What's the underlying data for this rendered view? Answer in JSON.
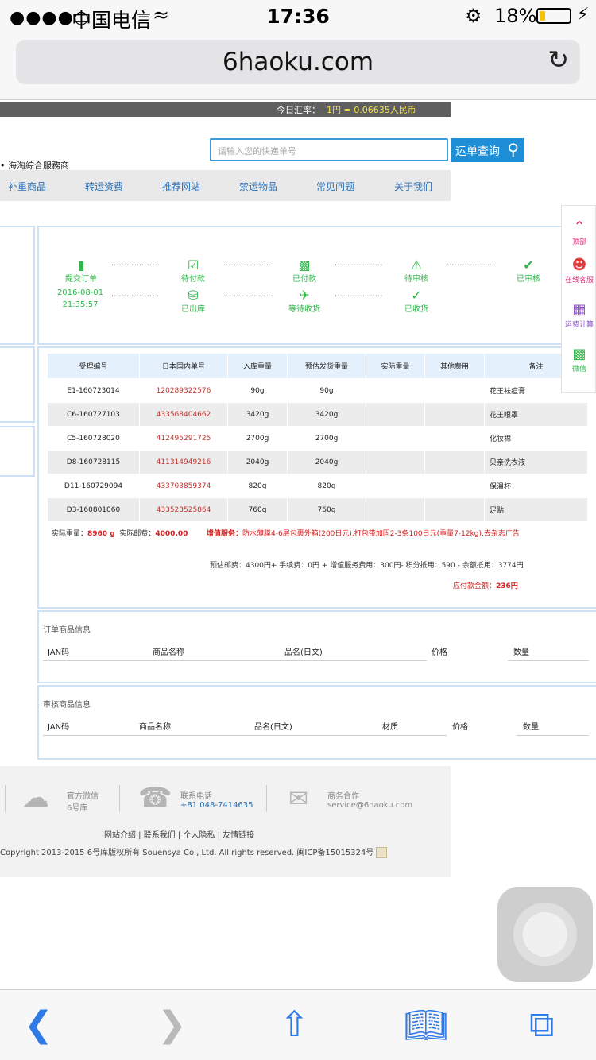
{
  "status": {
    "signal": "●●●●○",
    "carrier": "中国电信",
    "wifi_icon": "wifi-icon",
    "time": "17:36",
    "battery_percent": "18%",
    "battery_level": 0.18
  },
  "browser": {
    "url": "6haoku.com",
    "reload_icon": "reload-icon"
  },
  "rate": {
    "label": "今日汇率：",
    "value": "1円 = 0.06635人民币"
  },
  "search": {
    "placeholder": "请输入您的快递单号",
    "button": "运单查询"
  },
  "tagline": "• 海淘綜合服務商",
  "nav": [
    "补重商品",
    "转运资费",
    "推荐网站",
    "禁运物品",
    "常见问题",
    "关于我们"
  ],
  "progress": {
    "row1": [
      "提交订单",
      "待付款",
      "已付款",
      "待审核",
      "已审核"
    ],
    "row2": [
      "已出库",
      "等待收货",
      "已收货"
    ],
    "date": "2016-08-01",
    "clock": "21:35:57",
    "dots": "..................."
  },
  "table": {
    "headers": [
      "受理编号",
      "日本国内单号",
      "入库重量",
      "预估发货重量",
      "实际重量",
      "其他费用",
      "备注"
    ],
    "rows": [
      [
        "E1-160723014",
        "120289322576",
        "90g",
        "90g",
        "",
        "",
        "花王祛痘膏"
      ],
      [
        "C6-160727103",
        "433568404662",
        "3420g",
        "3420g",
        "",
        "",
        "花王眼罩"
      ],
      [
        "C5-160728020",
        "412495291725",
        "2700g",
        "2700g",
        "",
        "",
        "化妆棉"
      ],
      [
        "D8-160728115",
        "411314949216",
        "2040g",
        "2040g",
        "",
        "",
        "贝亲洗衣液"
      ],
      [
        "D11-160729094",
        "433703859374",
        "820g",
        "820g",
        "",
        "",
        "保温杯"
      ],
      [
        "D3-160801060",
        "433523525864",
        "760g",
        "760g",
        "",
        "",
        "足贴"
      ]
    ]
  },
  "summary": {
    "actual_weight_label": "实际重量：",
    "actual_weight": "8960 g",
    "actual_postage_label": "实际邮费：",
    "actual_postage": "4000.00",
    "service_label": "增值服务：",
    "service_text": "防水薄膜4-6层包裹外箱(200日元),打包带加固2-3条100日元(重量7-12kg),去杂志广告",
    "estimate": "预估邮费：4300円+ 手续费：0円 + 增值服务费用：300円- 积分抵用：590 - 余额抵用：3774円",
    "payable_label": "应付款金额：",
    "payable": "236円"
  },
  "order_goods": {
    "title": "订单商品信息",
    "cols": [
      "JAN码",
      "商品名称",
      "品名(日文)",
      "价格",
      "数量"
    ]
  },
  "review_goods": {
    "title": "审核商品信息",
    "cols": [
      "JAN码",
      "商品名称",
      "品名(日文)",
      "材质",
      "价格",
      "数量"
    ]
  },
  "side": [
    "顶部",
    "在线客服",
    "运费计算",
    "微信"
  ],
  "footer": {
    "wechat_label": "官方微信",
    "wechat_value": "6号库",
    "phone_label": "联系电话",
    "phone_value": "+81 048-7414635",
    "biz_label": "商务合作",
    "biz_value": "service@6haoku.com",
    "links": "网站介绍 | 联系我们 | 个人隐私 | 友情链接",
    "copyright": "Copyright 2013-2015 6号库版权所有 Souensya Co., Ltd. All rights reserved. 闽ICP备15015324号"
  },
  "colors": {
    "accent": "#1e8fd6",
    "green": "#2fb84a",
    "red": "#d42020",
    "link": "#2a6fb6"
  }
}
